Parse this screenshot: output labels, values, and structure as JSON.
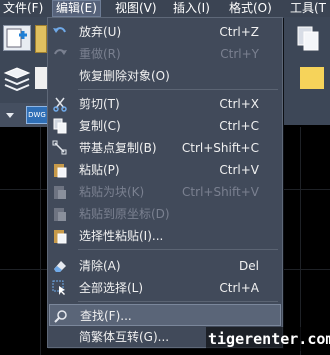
{
  "menubar": {
    "items": [
      {
        "label": "文件(F)"
      },
      {
        "label": "编辑(E)"
      },
      {
        "label": "视图(V)"
      },
      {
        "label": "插入(I)"
      },
      {
        "label": "格式(O)"
      },
      {
        "label": "工具(T"
      }
    ],
    "active_index": 1
  },
  "ribbon": {
    "tool_label": "DWG"
  },
  "edit_menu": {
    "items": [
      {
        "label": "放弃(U)",
        "shortcut": "Ctrl+Z",
        "icon": "undo-icon",
        "enabled": true
      },
      {
        "label": "重做(R)",
        "shortcut": "Ctrl+Y",
        "icon": "redo-icon",
        "enabled": false
      },
      {
        "label": "恢复删除对象(O)",
        "shortcut": "",
        "icon": "",
        "enabled": true
      },
      {
        "label": "剪切(T)",
        "shortcut": "Ctrl+X",
        "icon": "scissors-icon",
        "enabled": true
      },
      {
        "label": "复制(C)",
        "shortcut": "Ctrl+C",
        "icon": "copy-icon",
        "enabled": true
      },
      {
        "label": "带基点复制(B)",
        "shortcut": "Ctrl+Shift+C",
        "icon": "copy-with-basepoint-icon",
        "enabled": true
      },
      {
        "label": "粘贴(P)",
        "shortcut": "Ctrl+V",
        "icon": "paste-icon",
        "enabled": true
      },
      {
        "label": "粘贴为块(K)",
        "shortcut": "Ctrl+Shift+V",
        "icon": "paste-as-block-icon",
        "enabled": false
      },
      {
        "label": "粘贴到原坐标(D)",
        "shortcut": "",
        "icon": "paste-to-original-icon",
        "enabled": false
      },
      {
        "label": "选择性粘贴(I)...",
        "shortcut": "",
        "icon": "paste-special-icon",
        "enabled": true
      },
      {
        "label": "清除(A)",
        "shortcut": "Del",
        "icon": "eraser-icon",
        "enabled": true
      },
      {
        "label": "全部选择(L)",
        "shortcut": "Ctrl+A",
        "icon": "select-all-icon",
        "enabled": true
      },
      {
        "label": "查找(F)...",
        "shortcut": "",
        "icon": "find-icon",
        "enabled": true
      },
      {
        "label": "简繁体互转(G)...",
        "shortcut": "",
        "icon": "",
        "enabled": true
      }
    ],
    "highlighted_index": 12
  },
  "watermark": {
    "text": "tigerenter.com"
  },
  "colors": {
    "menubar_bg": "#3b4453",
    "menu_bg": "#414a5a",
    "highlight_bg": "#5a6578",
    "disabled_text": "#7a8090",
    "drawing_bg": "#000000"
  }
}
